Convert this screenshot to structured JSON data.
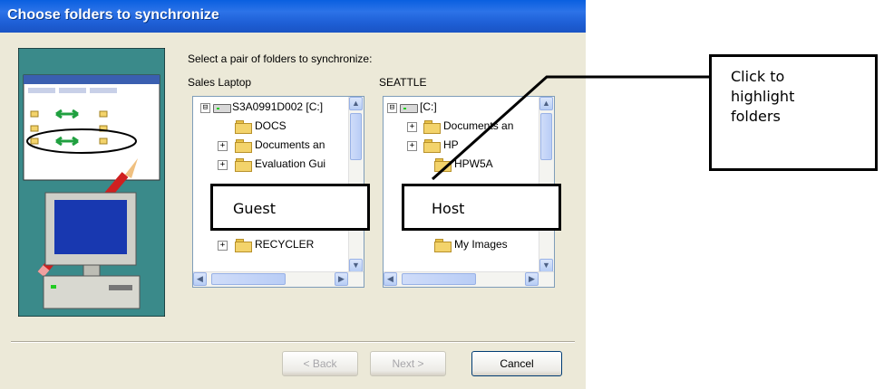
{
  "window": {
    "title": "Choose folders to synchronize",
    "instruction": "Select a pair of folders to synchronize:"
  },
  "guest_pane": {
    "label": "Sales Laptop",
    "items": [
      {
        "text": "S3A0991D002 [C:]",
        "icon": "drive-icon",
        "expander": "⊟"
      },
      {
        "text": "DOCS",
        "icon": "folder-icon",
        "expander": ""
      },
      {
        "text": "Documents an",
        "icon": "folder-icon",
        "expander": "+"
      },
      {
        "text": "Evaluation Gui",
        "icon": "folder-icon",
        "expander": "+"
      },
      {
        "text": "RECYCLER",
        "icon": "folder-icon",
        "expander": "+"
      }
    ],
    "overlay_label": "Guest"
  },
  "host_pane": {
    "label": "SEATTLE",
    "items": [
      {
        "text": "[C:]",
        "icon": "drive-icon",
        "expander": "⊟"
      },
      {
        "text": "Documents an",
        "icon": "folder-icon",
        "expander": "+"
      },
      {
        "text": "HP",
        "icon": "folder-icon",
        "expander": "+"
      },
      {
        "text": "HPW5A",
        "icon": "folder-icon",
        "expander": ""
      },
      {
        "text": "My Images",
        "icon": "folder-icon",
        "expander": ""
      }
    ],
    "overlay_label": "Host"
  },
  "buttons": {
    "back": "< Back",
    "next": "Next >",
    "cancel": "Cancel"
  },
  "annotation": {
    "text": "Click to\nhighlight\nfolders"
  },
  "colors": {
    "titlebar": "#1e5fd6",
    "dialog_bg": "#ece9d8",
    "illustration_bg": "#3a8a8a"
  }
}
